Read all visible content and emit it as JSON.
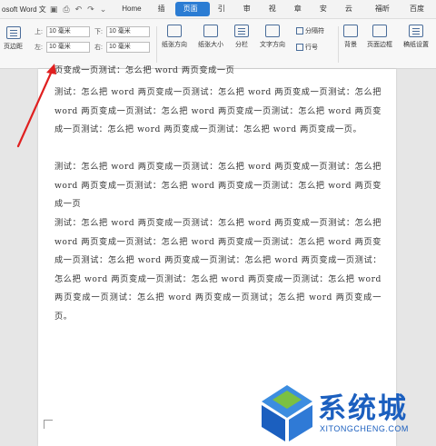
{
  "app": {
    "title": "osoft Word 文档"
  },
  "tabs": [
    "Home",
    "插入",
    "页面布局",
    "引用",
    "审阅",
    "视图",
    "章节",
    "安全",
    "云服务",
    "福昕PDF",
    "百度网盘"
  ],
  "active_tab": "页面布局",
  "ribbon": {
    "margins_label": "页边距",
    "top_label": "上:",
    "bottom_label": "下:",
    "left_label": "左:",
    "right_label": "右:",
    "top_value": "10 毫米",
    "bottom_value": "10 毫米",
    "left_value": "10 毫米",
    "right_value": "10 毫米",
    "orientation_label": "纸张方向",
    "size_label": "纸张大小",
    "columns_label": "分栏",
    "text_direction_label": "文字方向",
    "break_label": "分隔符",
    "line_number_label": "行号",
    "background_label": "背景",
    "border_label": "页面边框",
    "draft_label": "稿纸设置"
  },
  "document": {
    "cut_line": "页变成一页测试：怎么把 word 两页变成一页",
    "paragraphs": [
      "测试：怎么把 word 两页变成一页测试：怎么把 word 两页变成一页测试：怎么把 word 两页变成一页测试：怎么把 word 两页变成一页测试：怎么把 word 两页变成一页测试：怎么把 word 两页变成一页测试：怎么把 word 两页变成一页。",
      "测试：怎么把 word 两页变成一页测试：怎么把 word 两页变成一页测试：怎么把 word 两页变成一页测试：怎么把 word 两页变成一页测试：怎么把 word 两页变成一页",
      "测试：怎么把 word 两页变成一页测试：怎么把 word 两页变成一页测试：怎么把 word 两页变成一页测试：怎么把 word 两页变成一页测试：怎么把 word 两页变成一页测试：怎么把 word 两页变成一页测试：怎么把 word 两页变成一页测试：怎么把 word 两页变成一页测试：怎么把 word 两页变成一页测试：怎么把 word 两页变成一页测试：怎么把 word 两页变成一页测试；怎么把 word 两页变成一页。"
    ]
  },
  "watermark": {
    "text": "系统城",
    "url": "XITONGCHENG.COM"
  },
  "colors": {
    "accent": "#2b7cd3",
    "arrow": "#e02020",
    "watermark": "#1b5fbf"
  }
}
